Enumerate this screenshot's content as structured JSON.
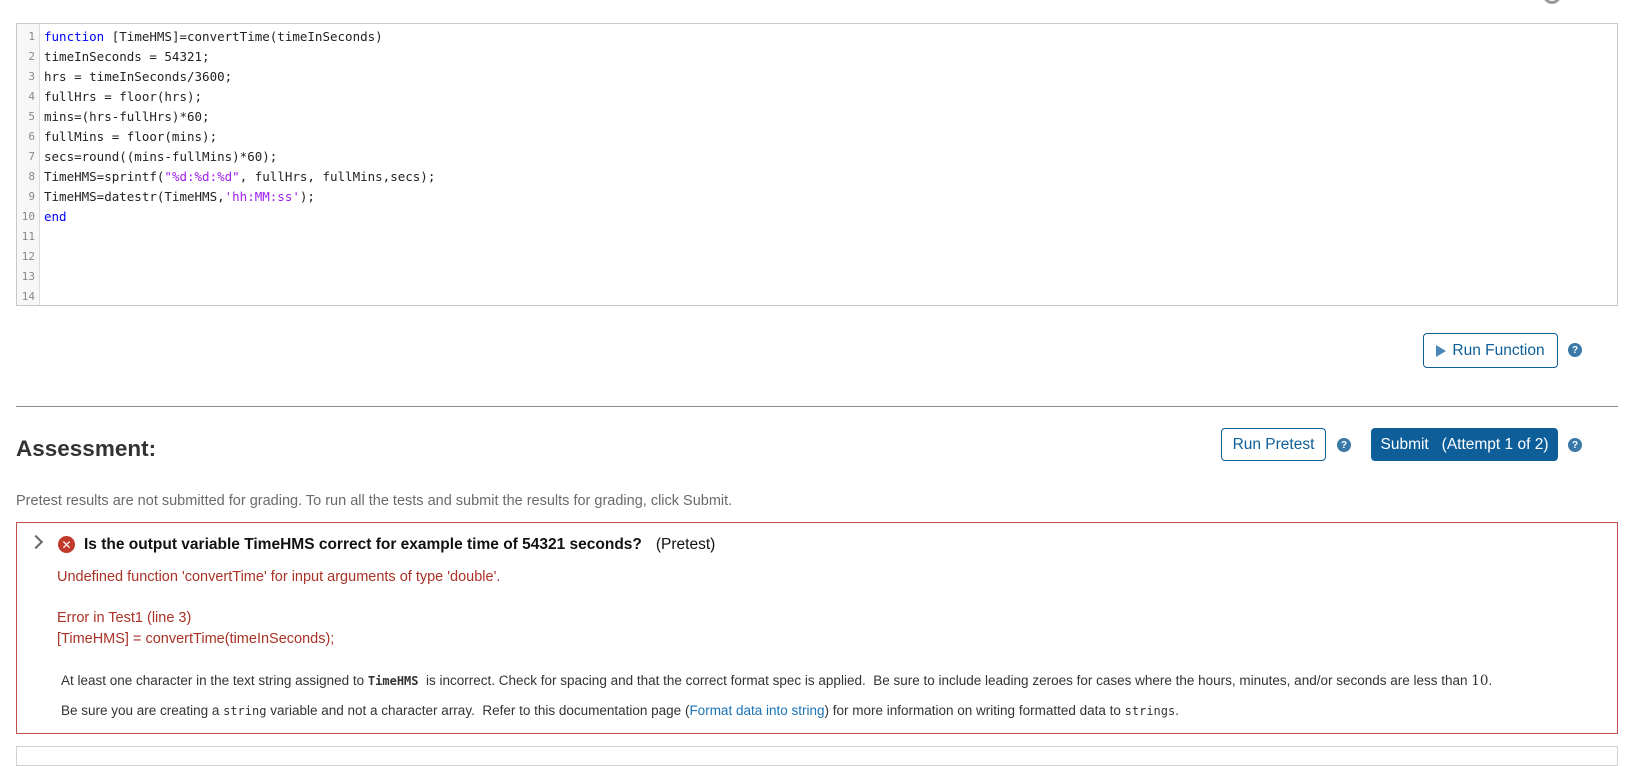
{
  "editor": {
    "lines": [
      {
        "num": "1",
        "segments": [
          {
            "text": "function",
            "type": "keyword"
          },
          {
            "text": " [TimeHMS]=convertTime(timeInSeconds)",
            "type": "plain"
          }
        ]
      },
      {
        "num": "2",
        "segments": [
          {
            "text": "timeInSeconds = 54321;",
            "type": "plain"
          }
        ]
      },
      {
        "num": "3",
        "segments": [
          {
            "text": "hrs = timeInSeconds/3600;",
            "type": "plain"
          }
        ]
      },
      {
        "num": "4",
        "segments": [
          {
            "text": "fullHrs = floor(hrs);",
            "type": "plain"
          }
        ]
      },
      {
        "num": "5",
        "segments": [
          {
            "text": "mins=(hrs-fullHrs)*60;",
            "type": "plain"
          }
        ]
      },
      {
        "num": "6",
        "segments": [
          {
            "text": "fullMins = floor(mins);",
            "type": "plain"
          }
        ]
      },
      {
        "num": "7",
        "segments": [
          {
            "text": "secs=round((mins-fullMins)*60);",
            "type": "plain"
          }
        ]
      },
      {
        "num": "8",
        "segments": [
          {
            "text": "TimeHMS=sprintf(",
            "type": "plain"
          },
          {
            "text": "\"%d:%d:%d\"",
            "type": "string"
          },
          {
            "text": ", fullHrs, fullMins,secs);",
            "type": "plain"
          }
        ]
      },
      {
        "num": "9",
        "segments": [
          {
            "text": "TimeHMS=datestr(TimeHMS,",
            "type": "plain"
          },
          {
            "text": "'hh:MM:ss'",
            "type": "string"
          },
          {
            "text": ");",
            "type": "plain"
          }
        ]
      },
      {
        "num": "10",
        "segments": [
          {
            "text": "end",
            "type": "keyword"
          }
        ]
      },
      {
        "num": "11",
        "segments": []
      },
      {
        "num": "12",
        "segments": []
      },
      {
        "num": "13",
        "segments": []
      },
      {
        "num": "14",
        "segments": []
      }
    ]
  },
  "run_function": {
    "label": "Run Function",
    "icon": "play-icon"
  },
  "help_glyph": "?",
  "assessment": {
    "title": "Assessment:",
    "run_pretest_label": "Run Pretest",
    "submit_label": "Submit   (Attempt 1 of 2)",
    "note": "Pretest results are not submitted for grading. To run all the tests and submit the results for grading, click Submit."
  },
  "test": {
    "status_icon": "error-icon",
    "status_glyph": "✕",
    "title": "Is the output variable TimeHMS correct for example time of 54321 seconds?",
    "tag": "(Pretest)",
    "error_message": "Undefined function 'convertTime' for input arguments of type 'double'.",
    "error_location": "Error in Test1 (line 3)",
    "error_code": "[TimeHMS] = convertTime(timeInSeconds);",
    "feedback1": {
      "pre": "At least one character in the text string assigned to ",
      "code": "TimeHMS",
      "post": "  is incorrect. Check for spacing and that the correct format spec is applied.  Be sure to include leading zeroes for cases where the hours, minutes, and/or seconds are less than ",
      "num": "10",
      "end": "."
    },
    "feedback2": {
      "pre": "Be sure you are creating a ",
      "code": "string",
      "mid": " variable and not a character array.  Refer to this documentation page (",
      "link": "Format data into string",
      "post": ") for more information on writing formatted data to ",
      "code2": "strings",
      "end": "."
    }
  },
  "colors": {
    "accent": "#0e5f99",
    "error": "#c0392b",
    "error_text": "#a93226",
    "keyword": "#0000ff",
    "string": "#a020f0",
    "link": "#1a73b5"
  }
}
